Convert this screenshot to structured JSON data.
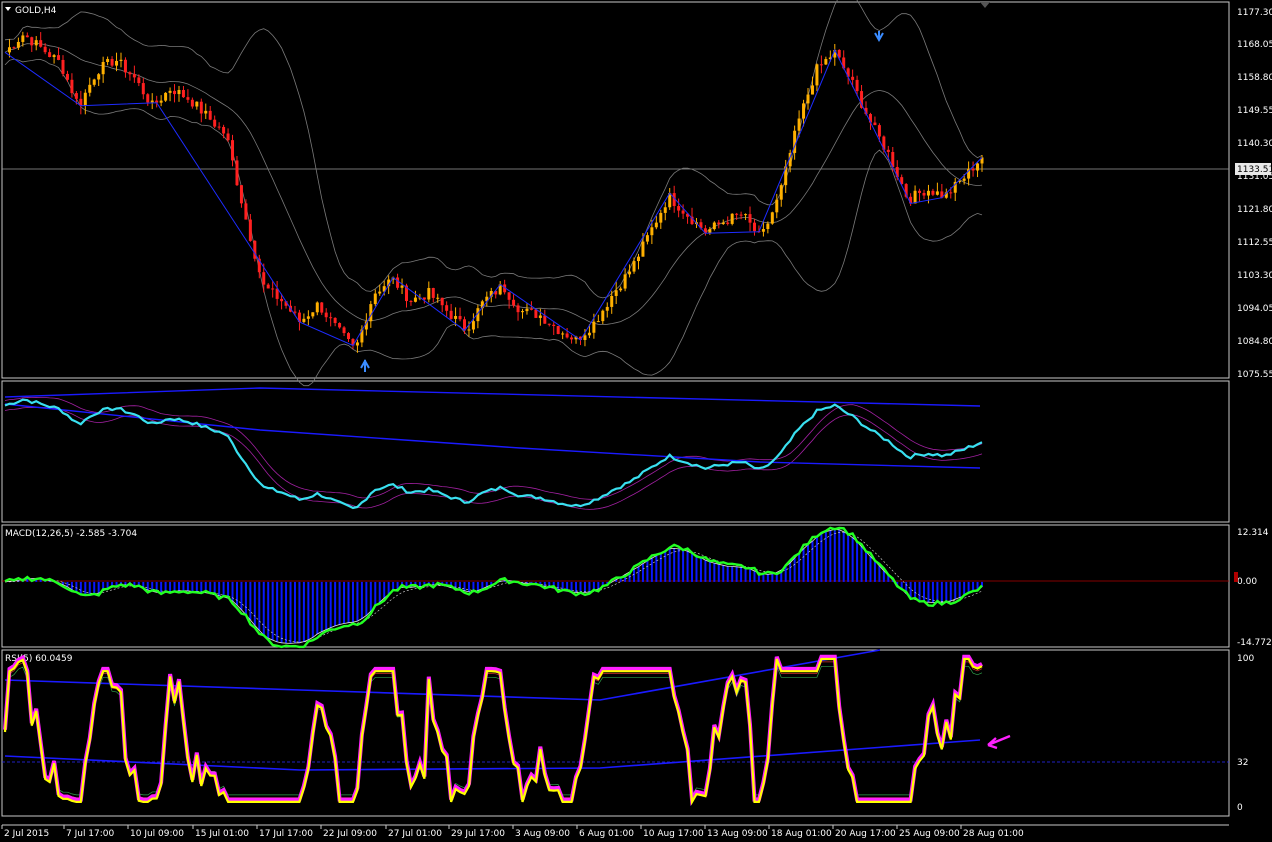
{
  "chart_data": [
    {
      "type": "candlestick",
      "panel": "price",
      "title": "GOLD,H4",
      "y_ticks": [
        "1177.30",
        "1168.05",
        "1158.80",
        "1149.55",
        "1140.30",
        "1131.05",
        "1121.80",
        "1112.55",
        "1103.30",
        "1094.05",
        "1084.80",
        "1075.55"
      ],
      "ylim": [
        1075.55,
        1177.3
      ],
      "current_price": "1133.51",
      "colors": {
        "up": "#ffb000",
        "down": "#ff2020",
        "bollinger": "#7a7a7a",
        "zigzag": "#1e2cff"
      },
      "approx_close_path": [
        1165,
        1170,
        1166,
        1162,
        1150,
        1160,
        1163,
        1158,
        1150,
        1155,
        1152,
        1147,
        1142,
        1120,
        1100,
        1096,
        1090,
        1095,
        1088,
        1082,
        1098,
        1102,
        1096,
        1098,
        1093,
        1088,
        1096,
        1100,
        1093,
        1092,
        1088,
        1085,
        1090,
        1098,
        1105,
        1115,
        1125,
        1120,
        1115,
        1118,
        1120,
        1113,
        1125,
        1145,
        1160,
        1165,
        1156,
        1145,
        1136,
        1124,
        1127,
        1125,
        1130,
        1136
      ]
    },
    {
      "type": "line",
      "panel": "oscillator",
      "series": [
        {
          "color": "#39e0f0"
        },
        {
          "color": "#1a1aff"
        },
        {
          "color": "#a020a0"
        }
      ]
    },
    {
      "type": "bar",
      "panel": "macd",
      "title": "MACD(12,26,5) -2.585 -3.704",
      "y_ticks": [
        "12.314",
        "0.00",
        "-14.772"
      ],
      "ylim": [
        -14.772,
        12.314
      ],
      "series": [
        {
          "name": "MACD",
          "color": "#0a18ff"
        },
        {
          "name": "Signal",
          "color": "#22ff22"
        }
      ]
    },
    {
      "type": "line",
      "panel": "rsi",
      "title": "RSI(5) 60.0459",
      "y_ticks": [
        "100",
        "32",
        "0"
      ],
      "ylim": [
        0,
        100
      ],
      "level": 32,
      "series": [
        {
          "color": "#ffff00"
        },
        {
          "color": "#ff20ff"
        },
        {
          "color": "#1a1aff"
        }
      ]
    }
  ],
  "x_ticks": [
    "2 Jul 2015",
    "7 Jul 17:00",
    "10 Jul 09:00",
    "15 Jul 01:00",
    "17 Jul 17:00",
    "22 Jul 09:00",
    "27 Jul 01:00",
    "29 Jul 17:00",
    "3 Aug 09:00",
    "6 Aug 01:00",
    "10 Aug 17:00",
    "13 Aug 09:00",
    "18 Aug 01:00",
    "20 Aug 17:00",
    "25 Aug 09:00",
    "28 Aug 01:00"
  ]
}
